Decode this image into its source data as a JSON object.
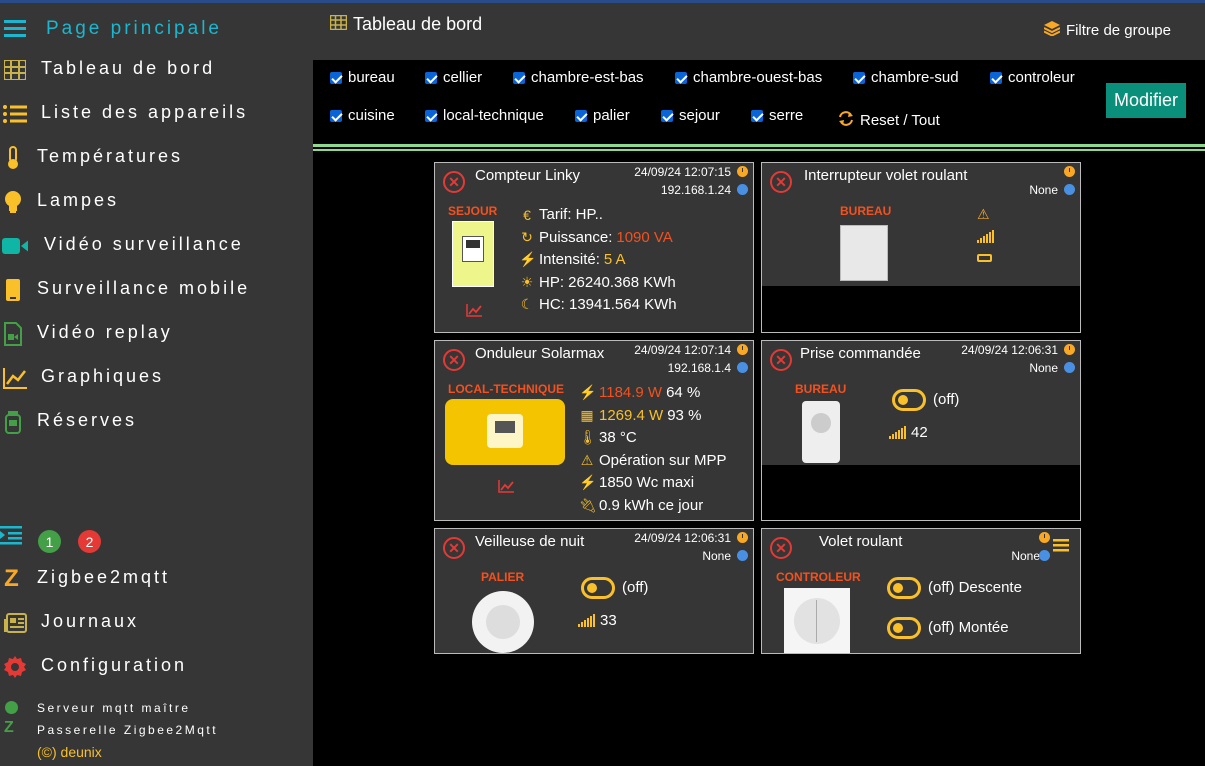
{
  "sidebar": {
    "home": "Page principale",
    "items": [
      {
        "label": "Tableau de bord",
        "icon": "grid-icon"
      },
      {
        "label": "Liste des appareils",
        "icon": "list-icon"
      },
      {
        "label": "Températures",
        "icon": "thermometer-icon"
      },
      {
        "label": "Lampes",
        "icon": "lightbulb-icon"
      },
      {
        "label": "Vidéo surveillance",
        "icon": "video-camera-icon"
      },
      {
        "label": "Surveillance mobile",
        "icon": "mobile-icon"
      },
      {
        "label": "Vidéo replay",
        "icon": "file-video-icon"
      },
      {
        "label": "Graphiques",
        "icon": "chart-line-icon"
      },
      {
        "label": "Réserves",
        "icon": "jar-icon"
      }
    ],
    "badges": {
      "green": "1",
      "red": "2"
    },
    "bottom_items": [
      {
        "label": "Zigbee2mqtt",
        "icon": "zigbee-icon"
      },
      {
        "label": "Journaux",
        "icon": "newspaper-icon"
      },
      {
        "label": "Configuration",
        "icon": "gear-icon"
      }
    ],
    "status": {
      "mqtt": "Serveur mqtt maître",
      "zigbee": "Passerelle Zigbee2Mqtt"
    },
    "copyright": "(©) deunix"
  },
  "header": {
    "title": "Tableau de bord",
    "group_filter": "Filtre de groupe"
  },
  "filters": {
    "groups": [
      "bureau",
      "cellier",
      "chambre-est-bas",
      "chambre-ouest-bas",
      "chambre-sud",
      "controleur",
      "cuisine",
      "local-technique",
      "palier",
      "sejour",
      "serre"
    ],
    "reset": "Reset / Tout",
    "modify": "Modifier"
  },
  "cards": {
    "linky": {
      "name": "Compteur Linky",
      "timestamp": "24/09/24 12:07:15",
      "ip": "192.168.1.24",
      "location": "SEJOUR",
      "tarif": "Tarif: HP..",
      "puissance_label": "Puissance:",
      "puissance": "1090 VA",
      "intensite_label": "Intensité:",
      "intensite": "5 A",
      "hp": "HP: 26240.368 KWh",
      "hc": "HC: 13941.564 KWh"
    },
    "volet_switch": {
      "name": "Interrupteur volet roulant",
      "ip": "None",
      "location": "BUREAU"
    },
    "solarmax": {
      "name": "Onduleur Solarmax",
      "timestamp": "24/09/24 12:07:14",
      "ip": "192.168.1.4",
      "location": "LOCAL-TECHNIQUE",
      "power": "1184.9 W",
      "power_pct": "64 %",
      "panel": "1269.4 W",
      "panel_pct": "93 %",
      "temp": "38 °C",
      "mode": "Opération sur MPP",
      "max": "1850 Wc maxi",
      "day": "0.9 kWh ce jour"
    },
    "prise": {
      "name": "Prise commandée",
      "timestamp": "24/09/24 12:06:31",
      "ip": "None",
      "location": "BUREAU",
      "state": "(off)",
      "signal": "42"
    },
    "veilleuse": {
      "name": "Veilleuse de nuit",
      "timestamp": "24/09/24 12:06:31",
      "ip": "None",
      "location": "PALIER",
      "state": "(off)",
      "signal": "33"
    },
    "volet": {
      "name": "Volet roulant",
      "ip": "None",
      "location": "CONTROLEUR",
      "down": "(off) Descente",
      "up": "(off) Montée"
    }
  },
  "colors": {
    "accent": "#19b8d0",
    "warning": "#f9c02a",
    "danger": "#e53935",
    "location": "#f4511e",
    "button": "#0a8f7a"
  }
}
